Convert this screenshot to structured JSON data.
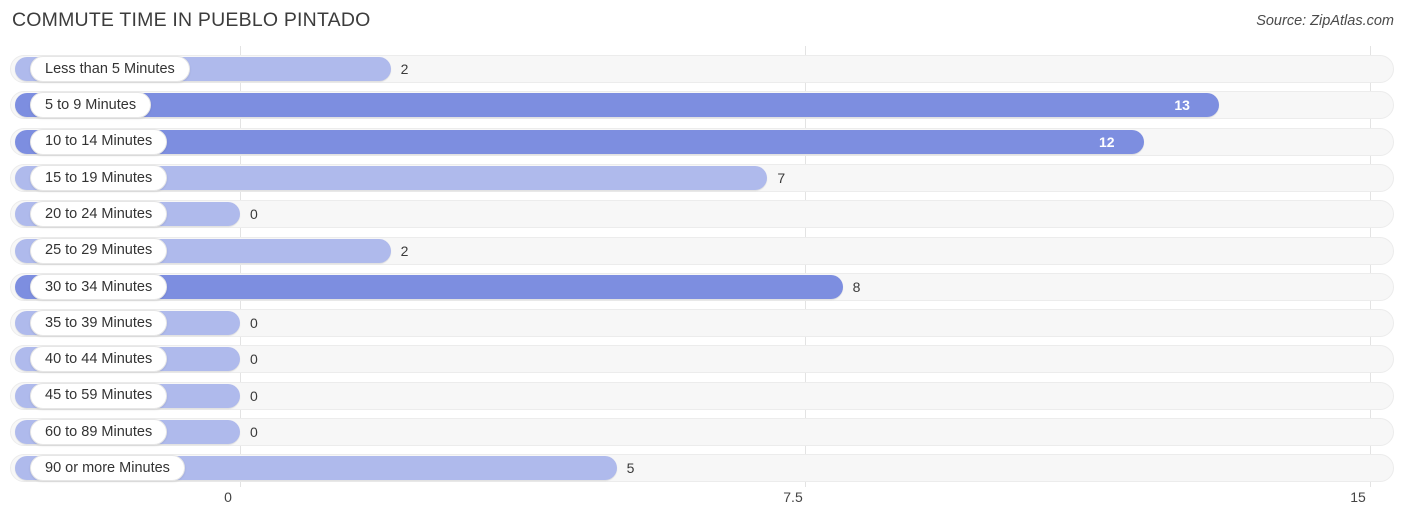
{
  "header": {
    "title": "COMMUTE TIME IN PUEBLO PINTADO",
    "source": "Source: ZipAtlas.com"
  },
  "colors": {
    "bar_light": "#afbaec",
    "bar_dark": "#7d8ee0",
    "track": "#f7f7f7",
    "gridline": "#e3e3e3",
    "label_pill": "#ffffff"
  },
  "chart_data": {
    "type": "bar",
    "orientation": "horizontal",
    "title": "COMMUTE TIME IN PUEBLO PINTADO",
    "subtitle": "",
    "xlabel": "",
    "ylabel": "",
    "xlim": [
      0,
      15
    ],
    "grid": true,
    "legend": null,
    "source": "Source: ZipAtlas.com",
    "tick_labels": [
      "0",
      "7.5",
      "15"
    ],
    "ticks": [
      0,
      7.5,
      15
    ],
    "categories": [
      "Less than 5 Minutes",
      "5 to 9 Minutes",
      "10 to 14 Minutes",
      "15 to 19 Minutes",
      "20 to 24 Minutes",
      "25 to 29 Minutes",
      "30 to 34 Minutes",
      "35 to 39 Minutes",
      "40 to 44 Minutes",
      "45 to 59 Minutes",
      "60 to 89 Minutes",
      "90 or more Minutes"
    ],
    "values": [
      2,
      13,
      12,
      7,
      0,
      2,
      8,
      0,
      0,
      0,
      0,
      5
    ],
    "value_labels": [
      "2",
      "13",
      "12",
      "7",
      "0",
      "2",
      "8",
      "0",
      "0",
      "0",
      "0",
      "5"
    ]
  },
  "rows": [
    {
      "label": "Less than 5 Minutes",
      "value": 2,
      "value_label": "2",
      "shade": "light",
      "inside": false
    },
    {
      "label": "5 to 9 Minutes",
      "value": 13,
      "value_label": "13",
      "shade": "dark",
      "inside": true
    },
    {
      "label": "10 to 14 Minutes",
      "value": 12,
      "value_label": "12",
      "shade": "dark",
      "inside": true
    },
    {
      "label": "15 to 19 Minutes",
      "value": 7,
      "value_label": "7",
      "shade": "light",
      "inside": false
    },
    {
      "label": "20 to 24 Minutes",
      "value": 0,
      "value_label": "0",
      "shade": "light",
      "inside": false
    },
    {
      "label": "25 to 29 Minutes",
      "value": 2,
      "value_label": "2",
      "shade": "light",
      "inside": false
    },
    {
      "label": "30 to 34 Minutes",
      "value": 8,
      "value_label": "8",
      "shade": "dark",
      "inside": false
    },
    {
      "label": "35 to 39 Minutes",
      "value": 0,
      "value_label": "0",
      "shade": "light",
      "inside": false
    },
    {
      "label": "40 to 44 Minutes",
      "value": 0,
      "value_label": "0",
      "shade": "light",
      "inside": false
    },
    {
      "label": "45 to 59 Minutes",
      "value": 0,
      "value_label": "0",
      "shade": "light",
      "inside": false
    },
    {
      "label": "60 to 89 Minutes",
      "value": 0,
      "value_label": "0",
      "shade": "light",
      "inside": false
    },
    {
      "label": "90 or more Minutes",
      "value": 5,
      "value_label": "5",
      "shade": "light",
      "inside": false
    }
  ],
  "axis": {
    "ticks": [
      {
        "label": "0",
        "value": 0
      },
      {
        "label": "7.5",
        "value": 7.5
      },
      {
        "label": "15",
        "value": 15
      }
    ]
  }
}
